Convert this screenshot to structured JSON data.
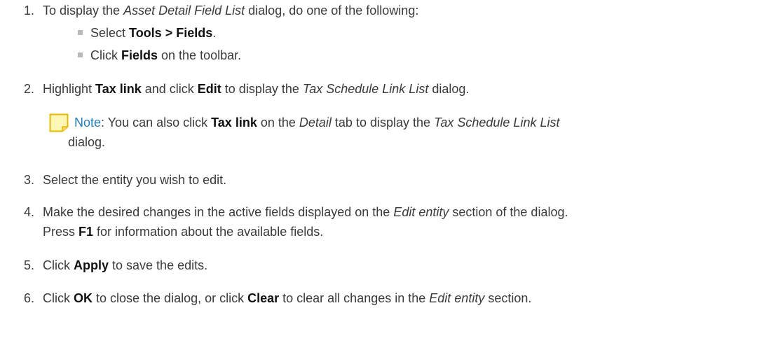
{
  "step1": {
    "num": "1.",
    "pre": "To display the ",
    "dialog": "Asset Detail Field List",
    "post": " dialog, do one of the following:",
    "bullets": [
      {
        "pre": "Select ",
        "bold": "Tools > Fields",
        "post": "."
      },
      {
        "pre": "Click ",
        "bold": "Fields",
        "post": " on the toolbar."
      }
    ]
  },
  "step2": {
    "num": "2.",
    "pre": "Highlight ",
    "b1": "Tax link",
    "mid": " and click ",
    "b2": "Edit",
    "mid2": " to display the ",
    "dialog": "Tax Schedule Link List",
    "post": " dialog."
  },
  "note": {
    "label": "Note",
    "t1": ": You can also click ",
    "b1": "Tax link",
    "t2": " on the ",
    "i1": "Detail",
    "t3": " tab to display the ",
    "i2": "Tax Schedule Link List",
    "line2": "dialog."
  },
  "step3": {
    "num": "3.",
    "text": "Select the entity you wish to edit."
  },
  "step4": {
    "num": "4.",
    "pre": "Make the desired changes in the active fields displayed on the ",
    "i1": "Edit entity",
    "post": " section of the dialog.",
    "l2pre": "Press ",
    "b1": "F1",
    "l2post": " for information about the available fields."
  },
  "step5": {
    "num": "5.",
    "pre": "Click ",
    "b1": "Apply",
    "post": " to save the edits."
  },
  "step6": {
    "num": "6.",
    "pre": "Click ",
    "b1": "OK",
    "mid": " to close the dialog, or click ",
    "b2": "Clear",
    "mid2": " to clear all changes in the ",
    "i1": "Edit entity",
    "post": " section."
  },
  "colors": {
    "note_label": "#1f7fc1",
    "bullet": "#b9b9b9",
    "note_icon_fill": "#fff7b8",
    "note_icon_border": "#e8b800"
  }
}
